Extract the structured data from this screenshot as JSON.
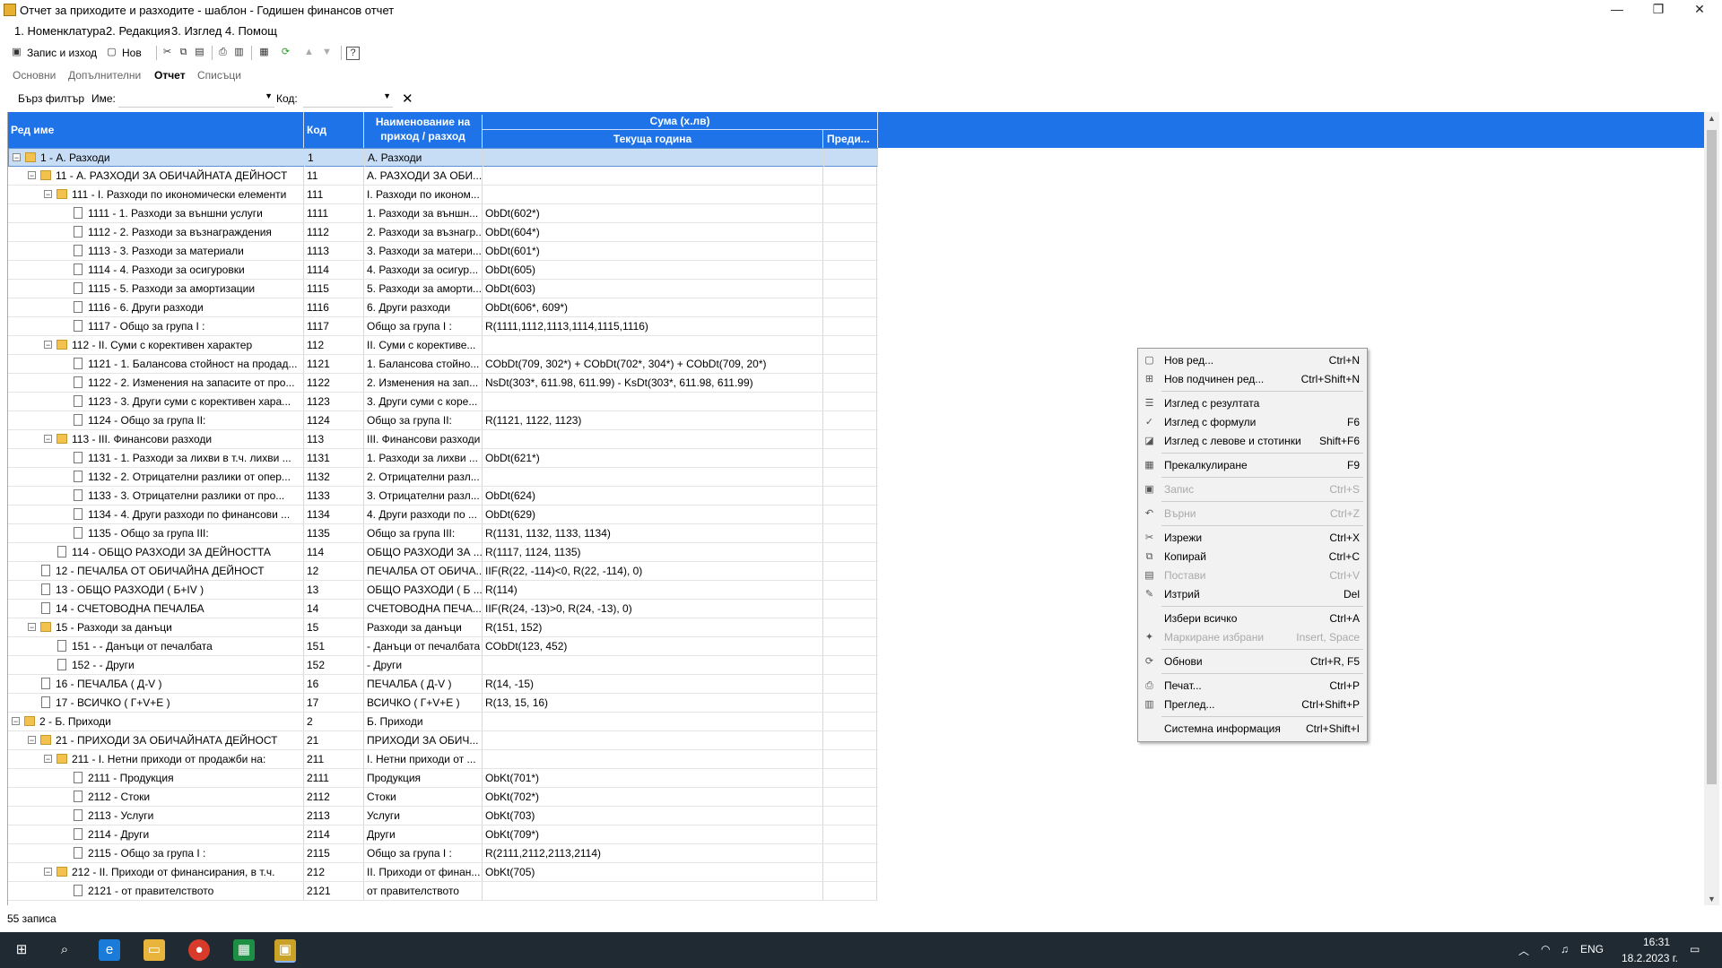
{
  "window": {
    "title": "Отчет за приходите и разходите - шаблон - Годишен финансов отчет",
    "minimize": "—",
    "maximize": "❐",
    "close": "✕"
  },
  "menu": [
    "1. Номенклатура",
    "2. Редакция",
    "3. Изглед",
    "4. Помощ"
  ],
  "toolbar": {
    "save_label": "Запис и изход",
    "new_label": "Нов"
  },
  "tabs": [
    "Основни",
    "Допълнителни",
    "Отчет",
    "Списъци"
  ],
  "active_tab": "Отчет",
  "filter": {
    "label": "Бърз филтър",
    "name_label": "Име:",
    "code_label": "Код:",
    "clear": "✕"
  },
  "grid": {
    "headers": {
      "row_name": "Ред име",
      "code": "Код",
      "name_line1": "Наименование на",
      "name_line2": "приход / разход",
      "sum": "Сума (х.лв)",
      "current": "Текуща година",
      "previous": "Преди..."
    },
    "rows": [
      {
        "level": 0,
        "type": "folder",
        "exp": "−",
        "label": "1 - А. Разходи",
        "code": "1",
        "name": "А. Разходи",
        "formula": ""
      },
      {
        "level": 1,
        "type": "folder",
        "exp": "−",
        "label": "11 -  А. РАЗХОДИ ЗА ОБИЧАЙНАТА ДЕЙНОСТ",
        "code": "11",
        "name": "А. РАЗХОДИ ЗА ОБИ...",
        "formula": ""
      },
      {
        "level": 2,
        "type": "folder",
        "exp": "−",
        "label": "111 -  I. Разходи по икономически елементи",
        "code": "111",
        "name": "I. Разходи по иконом...",
        "formula": ""
      },
      {
        "level": 3,
        "type": "doc",
        "label": "1111 -  1. Разходи за външни услуги",
        "code": "1111",
        "name": "1. Разходи за външн...",
        "formula": "ObDt(602*)"
      },
      {
        "level": 3,
        "type": "doc",
        "label": "1112 -  2. Разходи за възнаграждения",
        "code": "1112",
        "name": "2. Разходи за възнагр...",
        "formula": "ObDt(604*)"
      },
      {
        "level": 3,
        "type": "doc",
        "label": "1113 -  3. Разходи за материали",
        "code": "1113",
        "name": "3. Разходи за матери...",
        "formula": "ObDt(601*)"
      },
      {
        "level": 3,
        "type": "doc",
        "label": "1114 -  4. Разходи за осигуровки",
        "code": "1114",
        "name": "4. Разходи за осигур...",
        "formula": "ObDt(605)"
      },
      {
        "level": 3,
        "type": "doc",
        "label": "1115 -  5. Разходи за амортизации",
        "code": "1115",
        "name": "5. Разходи за аморти...",
        "formula": "ObDt(603)"
      },
      {
        "level": 3,
        "type": "doc",
        "label": "1116 -  6. Други разходи",
        "code": "1116",
        "name": "6. Други разходи",
        "formula": "ObDt(606*, 609*)"
      },
      {
        "level": 3,
        "type": "doc",
        "label": "1117 - Общо за група I :",
        "code": "1117",
        "name": "Общо за група I :",
        "formula": "R(1111,1112,1113,1114,1115,1116)"
      },
      {
        "level": 2,
        "type": "folder",
        "exp": "−",
        "label": "112 -  II. Суми с корективен характер",
        "code": "112",
        "name": "II. Суми с корективе...",
        "formula": ""
      },
      {
        "level": 3,
        "type": "doc",
        "label": "1121 -  1. Балансова стойност на продад...",
        "code": "1121",
        "name": "1. Балансова стойно...",
        "formula": "CObDt(709, 302*) + CObDt(702*, 304*) + CObDt(709, 20*)"
      },
      {
        "level": 3,
        "type": "doc",
        "label": "1122 -  2. Изменения на запасите от про...",
        "code": "1122",
        "name": "2. Изменения на зап...",
        "formula": "NsDt(303*, 611.98, 611.99) - KsDt(303*, 611.98, 611.99)"
      },
      {
        "level": 3,
        "type": "doc",
        "label": "1123 -  3. Други суми с корективен хара...",
        "code": "1123",
        "name": "3. Други суми с коре...",
        "formula": ""
      },
      {
        "level": 3,
        "type": "doc",
        "label": "1124 - Общо за група II:",
        "code": "1124",
        "name": "Общо за група II:",
        "formula": "R(1121, 1122, 1123)"
      },
      {
        "level": 2,
        "type": "folder",
        "exp": "−",
        "label": "113 -  III. Финансови разходи",
        "code": "113",
        "name": " III. Финансови разходи",
        "formula": ""
      },
      {
        "level": 3,
        "type": "doc",
        "label": "1131 -   1. Разходи за лихви в т.ч. лихви ...",
        "code": "1131",
        "name": " 1. Разходи за лихви ...",
        "formula": "ObDt(621*)"
      },
      {
        "level": 3,
        "type": "doc",
        "label": "1132 -   2. Отрицателни разлики от опер...",
        "code": "1132",
        "name": " 2. Отрицателни разл...",
        "formula": ""
      },
      {
        "level": 3,
        "type": "doc",
        "label": "1133 -   3. Отрицателни разлики от про...",
        "code": "1133",
        "name": " 3. Отрицателни разл...",
        "formula": "ObDt(624)"
      },
      {
        "level": 3,
        "type": "doc",
        "label": "1134 -   4. Други разходи по финансови ...",
        "code": "1134",
        "name": " 4. Други разходи по ...",
        "formula": "ObDt(629)"
      },
      {
        "level": 3,
        "type": "doc",
        "label": "1135 - Общо за група III:",
        "code": "1135",
        "name": "Общо за група III:",
        "formula": "R(1131, 1132, 1133, 1134)"
      },
      {
        "level": 2,
        "type": "doc",
        "label": "114 - ОБЩО РАЗХОДИ ЗА ДЕЙНОСТТА",
        "code": "114",
        "name": "ОБЩО РАЗХОДИ ЗА ...",
        "formula": "R(1117, 1124, 1135)"
      },
      {
        "level": 1,
        "type": "doc",
        "label": "12 - ПЕЧАЛБА ОТ ОБИЧАЙНА ДЕЙНОСТ",
        "code": "12",
        "name": "ПЕЧАЛБА ОТ ОБИЧА...",
        "formula": "IIF(R(22, -114)<0, R(22, -114), 0)"
      },
      {
        "level": 1,
        "type": "doc",
        "label": "13 - ОБЩО РАЗХОДИ ( Б+IV )",
        "code": "13",
        "name": "ОБЩО РАЗХОДИ ( Б ...",
        "formula": "R(114)"
      },
      {
        "level": 1,
        "type": "doc",
        "label": "14 - СЧЕТОВОДНА ПЕЧАЛБА",
        "code": "14",
        "name": "СЧЕТОВОДНА ПЕЧА...",
        "formula": "IIF(R(24, -13)>0, R(24, -13), 0)"
      },
      {
        "level": 1,
        "type": "folder",
        "exp": "−",
        "label": "15 - Разходи за данъци",
        "code": "15",
        "name": "Разходи за данъци",
        "formula": "R(151, 152)"
      },
      {
        "level": 2,
        "type": "doc",
        "label": "151 -  - Данъци от печалбата",
        "code": "151",
        "name": " - Данъци от печалбата",
        "formula": "CObDt(123, 452)"
      },
      {
        "level": 2,
        "type": "doc",
        "label": "152 -  - Други",
        "code": "152",
        "name": " - Други",
        "formula": ""
      },
      {
        "level": 1,
        "type": "doc",
        "label": "16 - ПЕЧАЛБА ( Д-V )",
        "code": "16",
        "name": "ПЕЧАЛБА ( Д-V )",
        "formula": "R(14, -15)"
      },
      {
        "level": 1,
        "type": "doc",
        "label": "17 - ВСИЧКО ( Г+V+Е )",
        "code": "17",
        "name": "ВСИЧКО ( Г+V+Е )",
        "formula": "R(13, 15, 16)"
      },
      {
        "level": 0,
        "type": "folder",
        "exp": "−",
        "label": "2 - Б. Приходи",
        "code": "2",
        "name": "Б. Приходи",
        "formula": ""
      },
      {
        "level": 1,
        "type": "folder",
        "exp": "−",
        "label": "21 - ПРИХОДИ ЗА ОБИЧАЙНАТА ДЕЙНОСТ",
        "code": "21",
        "name": "ПРИХОДИ ЗА ОБИЧ...",
        "formula": ""
      },
      {
        "level": 2,
        "type": "folder",
        "exp": "−",
        "label": "211 -  I. Нетни приходи от продажби на:",
        "code": "211",
        "name": "I. Нетни приходи от ...",
        "formula": ""
      },
      {
        "level": 3,
        "type": "doc",
        "label": "2111 -      Продукция",
        "code": "2111",
        "name": "    Продукция",
        "formula": "ObKt(701*)"
      },
      {
        "level": 3,
        "type": "doc",
        "label": "2112 -      Стоки",
        "code": "2112",
        "name": "    Стоки",
        "formula": "ObKt(702*)"
      },
      {
        "level": 3,
        "type": "doc",
        "label": "2113 -      Услуги",
        "code": "2113",
        "name": "    Услуги",
        "formula": "ObKt(703)"
      },
      {
        "level": 3,
        "type": "doc",
        "label": "2114 -      Други",
        "code": "2114",
        "name": "    Други",
        "formula": "ObKt(709*)"
      },
      {
        "level": 3,
        "type": "doc",
        "label": "2115 -  Общо за група I :",
        "code": "2115",
        "name": " Общо за група I :",
        "formula": "R(2111,2112,2113,2114)"
      },
      {
        "level": 2,
        "type": "folder",
        "exp": "−",
        "label": "212 -  II. Приходи от финансирания, в т.ч.",
        "code": "212",
        "name": "II. Приходи от финан...",
        "formula": "ObKt(705)"
      },
      {
        "level": 3,
        "type": "doc",
        "label": "2121 -  от правителството",
        "code": "2121",
        "name": "от правителството",
        "formula": ""
      }
    ]
  },
  "status": "55 записа",
  "context_menu": [
    {
      "icon": "new-row-icon",
      "g": "▢",
      "label": "Нов ред...",
      "shortcut": "Ctrl+N",
      "disabled": false
    },
    {
      "icon": "new-child-row-icon",
      "g": "⊞",
      "label": "Нов подчинен ред...",
      "shortcut": "Ctrl+Shift+N",
      "disabled": false
    },
    {
      "sep": true
    },
    {
      "icon": "view-result-icon",
      "g": "☰",
      "label": "Изглед с резултата",
      "shortcut": "",
      "disabled": false
    },
    {
      "icon": "check-icon",
      "g": "✓",
      "label": "Изглед с формули",
      "shortcut": "F6",
      "disabled": false
    },
    {
      "icon": "view-currency-icon",
      "g": "◪",
      "label": "Изглед с левове и стотинки",
      "shortcut": "Shift+F6",
      "disabled": false
    },
    {
      "sep": true
    },
    {
      "icon": "recalculate-icon",
      "g": "▦",
      "label": "Прекалкулиране",
      "shortcut": "F9",
      "disabled": false
    },
    {
      "sep": true
    },
    {
      "icon": "save-icon",
      "g": "▣",
      "label": "Запис",
      "shortcut": "Ctrl+S",
      "disabled": true
    },
    {
      "sep": true
    },
    {
      "icon": "undo-icon",
      "g": "↶",
      "label": "Върни",
      "shortcut": "Ctrl+Z",
      "disabled": true
    },
    {
      "sep": true
    },
    {
      "icon": "cut-icon",
      "g": "✂",
      "label": "Изрежи",
      "shortcut": "Ctrl+X",
      "disabled": false
    },
    {
      "icon": "copy-icon",
      "g": "⧉",
      "label": "Копирай",
      "shortcut": "Ctrl+C",
      "disabled": false
    },
    {
      "icon": "paste-icon",
      "g": "▤",
      "label": "Постави",
      "shortcut": "Ctrl+V",
      "disabled": true
    },
    {
      "icon": "delete-icon",
      "g": "✎",
      "label": "Изтрий",
      "shortcut": "Del",
      "disabled": false
    },
    {
      "sep": true
    },
    {
      "icon": "",
      "g": "",
      "label": "Избери всичко",
      "shortcut": "Ctrl+A",
      "disabled": false
    },
    {
      "icon": "mark-selected-icon",
      "g": "✦",
      "label": "Маркиране избрани",
      "shortcut": "Insert, Space",
      "disabled": true
    },
    {
      "sep": true
    },
    {
      "icon": "refresh-icon",
      "g": "⟳",
      "label": "Обнови",
      "shortcut": "Ctrl+R, F5",
      "disabled": false
    },
    {
      "sep": true
    },
    {
      "icon": "print-icon",
      "g": "⎙",
      "label": "Печат...",
      "shortcut": "Ctrl+P",
      "disabled": false
    },
    {
      "icon": "preview-icon",
      "g": "▥",
      "label": "Преглед...",
      "shortcut": "Ctrl+Shift+P",
      "disabled": false
    },
    {
      "sep": true
    },
    {
      "icon": "",
      "g": "",
      "label": "Системна информация",
      "shortcut": "Ctrl+Shift+I",
      "disabled": false
    }
  ],
  "taskbar": {
    "lang": "ENG",
    "time": "16:31",
    "date": "18.2.2023 г."
  },
  "colors": {
    "header_blue": "#1e73e8",
    "selected_row": "#c7dcf5",
    "taskbar": "#1f2a33"
  }
}
